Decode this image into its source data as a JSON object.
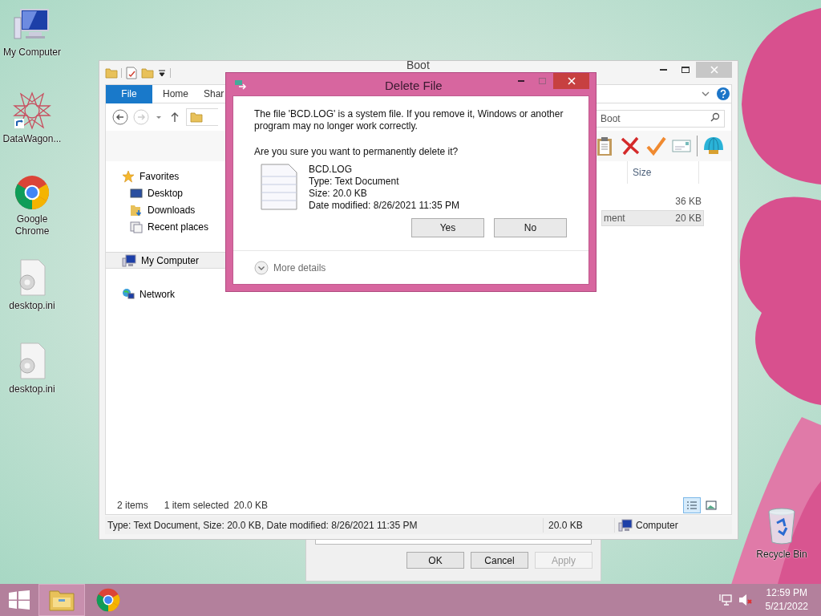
{
  "desktop_icons": [
    {
      "label": "My Computer",
      "kind": "computer"
    },
    {
      "label": "DataWagon...",
      "kind": "star"
    },
    {
      "label": "Google Chrome",
      "kind": "chrome"
    },
    {
      "label": "desktop.ini",
      "kind": "ini"
    },
    {
      "label": "desktop.ini",
      "kind": "ini"
    },
    {
      "label": "Recycle Bin",
      "kind": "bin"
    }
  ],
  "explorer": {
    "title": "Boot",
    "ribbon_tabs": [
      {
        "label": "File",
        "selected": true
      },
      {
        "label": "Home",
        "selected": false
      },
      {
        "label": "Shar",
        "selected": false
      }
    ],
    "search": {
      "placeholder": "Boot"
    },
    "column_header": "Size",
    "rows": [
      {
        "size": "36 KB",
        "selected": false
      },
      {
        "type": "ment",
        "size": "20 KB",
        "selected": true
      }
    ],
    "sidebar": [
      {
        "label": "Favorites",
        "kind": "star",
        "selected": false,
        "children": [
          {
            "label": "Desktop",
            "kind": "desktop",
            "selected": false
          },
          {
            "label": "Downloads",
            "kind": "downloads",
            "selected": false
          },
          {
            "label": "Recent places",
            "kind": "recent",
            "selected": false
          }
        ]
      },
      {
        "label": "My Computer",
        "kind": "computer",
        "selected": true
      },
      {
        "label": "Network",
        "kind": "network",
        "selected": false
      }
    ],
    "status": {
      "item_count": "2 items",
      "selection": "1 item selected",
      "selection_size": "20.0 KB"
    },
    "view_buttons": [
      {
        "kind": "details",
        "selected": true
      },
      {
        "kind": "tiles",
        "selected": false
      }
    ],
    "details_bar": {
      "description": "Type: Text Document, Size: 20.0 KB, Date modified: 8/26/2021 11:35 PM",
      "size": "20.0 KB",
      "location": "Computer"
    }
  },
  "background_dialog": {
    "buttons": [
      {
        "label": "OK",
        "disabled": false
      },
      {
        "label": "Cancel",
        "disabled": false
      },
      {
        "label": "Apply",
        "disabled": true
      }
    ]
  },
  "dialog": {
    "title": "Delete File",
    "message": "The file 'BCD.LOG' is a system file. If you remove it, Windows or another program may no longer work correctly.",
    "question": "Are you sure you want to permanently delete it?",
    "file": {
      "name": "BCD.LOG",
      "type": "Type: Text Document",
      "size": "Size: 20.0 KB",
      "modified": "Date modified: 8/26/2021 11:35 PM"
    },
    "buttons": [
      {
        "label": "Yes"
      },
      {
        "label": "No"
      }
    ],
    "more_details": "More details"
  },
  "taskbar": {
    "apps": [
      {
        "kind": "explorer",
        "selected": true
      },
      {
        "kind": "chrome",
        "selected": false
      }
    ],
    "volume_muted": true,
    "time": "12:59 PM",
    "date": "5/21/2022"
  }
}
